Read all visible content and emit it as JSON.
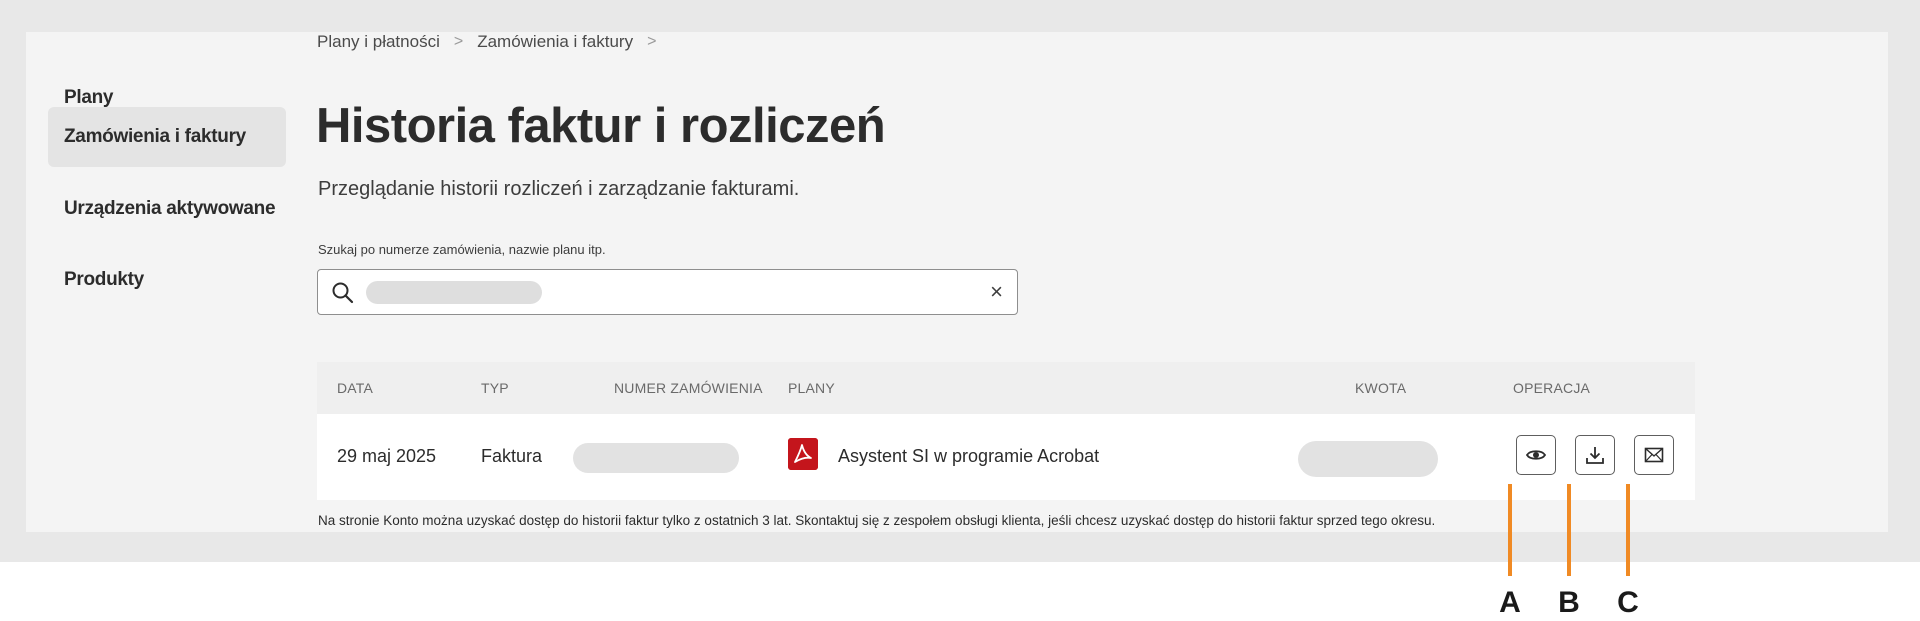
{
  "sidebar": {
    "items": [
      {
        "label": "Plany",
        "active": false
      },
      {
        "label": "Zamówienia i faktury",
        "active": true
      },
      {
        "label": "Urządzenia aktywowane",
        "active": false
      },
      {
        "label": "Produkty",
        "active": false
      }
    ]
  },
  "breadcrumb": {
    "items": [
      "Plany i płatności",
      "Zamówienia i faktury"
    ],
    "separator": ">"
  },
  "page": {
    "title": "Historia faktur i rozliczeń",
    "subtitle": "Przeglądanie historii rozliczeń i zarządzanie fakturami."
  },
  "search": {
    "label": "Szukaj po numerze zamówienia, nazwie planu itp.",
    "value": "",
    "clear": "×"
  },
  "table": {
    "headers": {
      "date": "DATA",
      "type": "TYP",
      "order_number": "NUMER ZAMÓWIENIA",
      "plans": "PLANY",
      "amount": "KWOTA",
      "operation": "OPERACJA"
    },
    "rows": [
      {
        "date": "29 maj 2025",
        "type": "Faktura",
        "order_number": "",
        "plan": "Asystent SI w programie Acrobat",
        "amount": ""
      }
    ]
  },
  "footnote": "Na stronie Konto można uzyskać dostęp do historii faktur tylko z ostatnich 3 lat. Skontaktuj się z zespołem obsługi klienta, jeśli chcesz uzyskać dostęp do historii faktur sprzed tego okresu.",
  "callouts": [
    "A",
    "B",
    "C"
  ],
  "colors": {
    "accent_callout": "#f08a24",
    "pdf_icon": "#c4151c"
  }
}
